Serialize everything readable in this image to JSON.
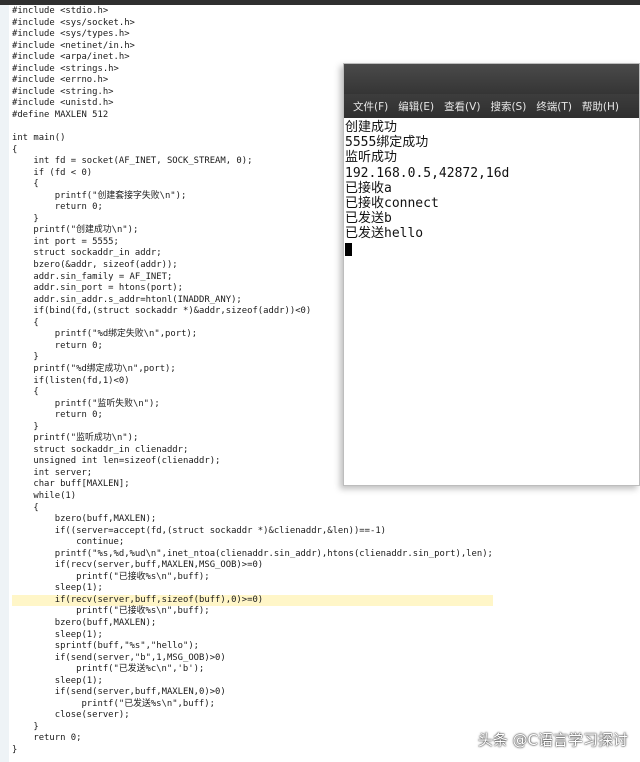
{
  "editor": {
    "code_lines": [
      "#include <stdio.h>",
      "#include <sys/socket.h>",
      "#include <sys/types.h>",
      "#include <netinet/in.h>",
      "#include <arpa/inet.h>",
      "#include <strings.h>",
      "#include <errno.h>",
      "#include <string.h>",
      "#include <unistd.h>",
      "#define MAXLEN 512",
      "",
      "int main()",
      "{",
      "    int fd = socket(AF_INET, SOCK_STREAM, 0);",
      "    if (fd < 0)",
      "    {",
      "        printf(\"创建套接字失败\\n\");",
      "        return 0;",
      "    }",
      "    printf(\"创建成功\\n\");",
      "    int port = 5555;",
      "    struct sockaddr_in addr;",
      "    bzero(&addr, sizeof(addr));",
      "    addr.sin_family = AF_INET;",
      "    addr.sin_port = htons(port);",
      "    addr.sin_addr.s_addr=htonl(INADDR_ANY);",
      "    if(bind(fd,(struct sockaddr *)&addr,sizeof(addr))<0)",
      "    {",
      "        printf(\"%d绑定失败\\n\",port);",
      "        return 0;",
      "    }",
      "    printf(\"%d绑定成功\\n\",port);",
      "    if(listen(fd,1)<0)",
      "    {",
      "        printf(\"监听失败\\n\");",
      "        return 0;",
      "    }",
      "    printf(\"监听成功\\n\");",
      "    struct sockaddr_in clienaddr;",
      "    unsigned int len=sizeof(clienaddr);",
      "    int server;",
      "    char buff[MAXLEN];",
      "    while(1)",
      "    {",
      "        bzero(buff,MAXLEN);",
      "        if((server=accept(fd,(struct sockaddr *)&clienaddr,&len))==-1)",
      "            continue;",
      "        printf(\"%s,%d,%ud\\n\",inet_ntoa(clienaddr.sin_addr),htons(clienaddr.sin_port),len);",
      "        if(recv(server,buff,MAXLEN,MSG_OOB)>=0)",
      "            printf(\"已接收%s\\n\",buff);",
      "        sleep(1);",
      "        if(recv(server,buff,sizeof(buff),0)>=0)",
      "            printf(\"已接收%s\\n\",buff);",
      "        bzero(buff,MAXLEN);",
      "        sleep(1);",
      "        sprintf(buff,\"%s\",\"hello\");",
      "        if(send(server,\"b\",1,MSG_OOB)>0)",
      "            printf(\"已发送%c\\n\",'b');",
      "        sleep(1);",
      "        if(send(server,buff,MAXLEN,0)>0)",
      "             printf(\"已发送%s\\n\",buff);",
      "        close(server);",
      "    }",
      "    return 0;",
      "}"
    ],
    "highlighted_line": 51
  },
  "terminal": {
    "menu": [
      "文件(F)",
      "编辑(E)",
      "查看(V)",
      "搜索(S)",
      "终端(T)",
      "帮助(H)"
    ],
    "output_lines": [
      "创建成功",
      "5555绑定成功",
      "监听成功",
      "192.168.0.5,42872,16d",
      "已接收a",
      "已接收connect",
      "已发送b",
      "已发送hello"
    ]
  },
  "watermark": "头条 @C语言学习探讨",
  "colors": {
    "code_text": "#1a1a1a",
    "gutter": "#eef3f6",
    "menubar_bg": "#333333",
    "menubar_text": "#e6e6e6",
    "terminal_bg": "#ffffff"
  }
}
